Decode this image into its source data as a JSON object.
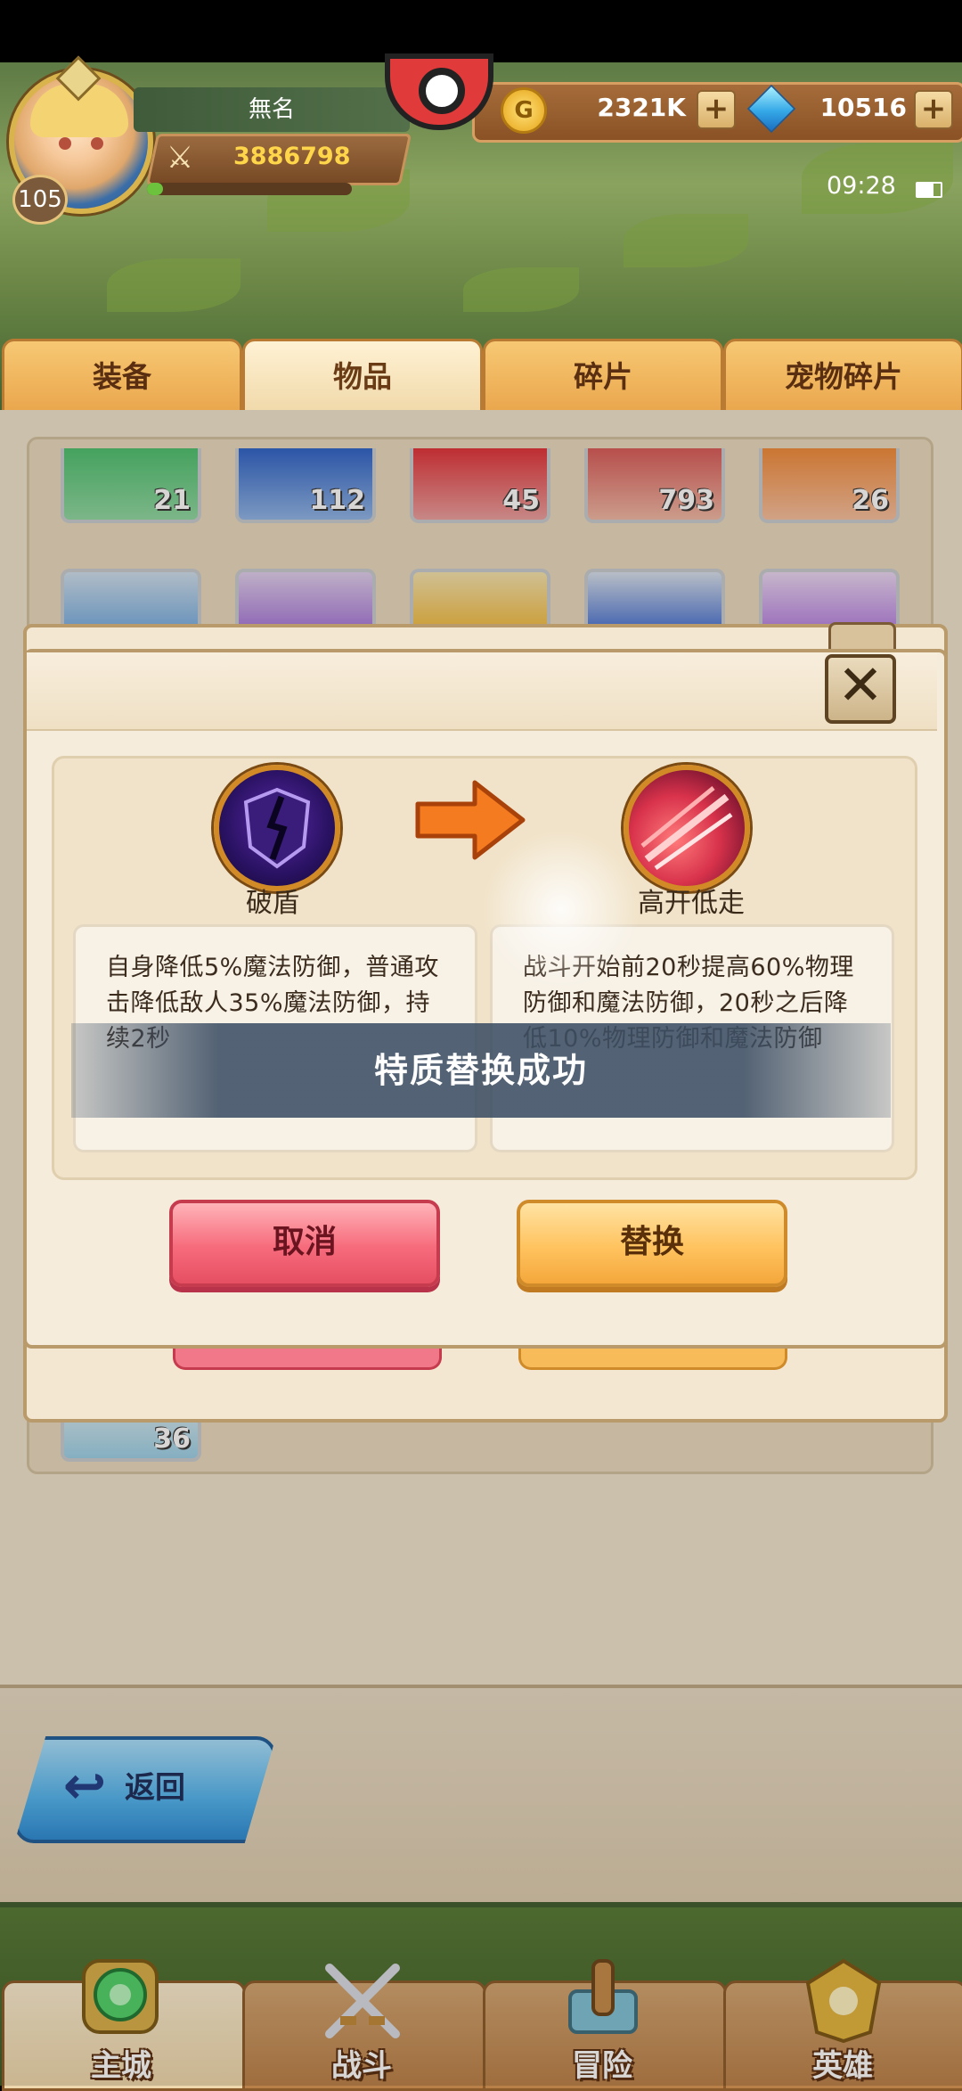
{
  "player": {
    "name": "無名",
    "level": "105",
    "power": "3886798",
    "exp_fraction": 0.08
  },
  "currency": {
    "gold": "2321K",
    "gold_symbol": "G",
    "gems": "10516",
    "plus": "+"
  },
  "status": {
    "time": "09:28"
  },
  "tabs": [
    "装备",
    "物品",
    "碎片",
    "宠物碎片"
  ],
  "active_tab": "物品",
  "inventory": {
    "row1_counts": [
      "21",
      "112",
      "45",
      "793",
      "26"
    ],
    "last_count": "36"
  },
  "dialog": {
    "close_glyph": "✕",
    "old_trait": {
      "name": "破盾",
      "desc": "自身降低5%魔法防御，普通攻击降低敌人35%魔法防御，持续2秒"
    },
    "new_trait": {
      "name": "高开低走",
      "desc": "战斗开始前20秒提高60%物理防御和魔法防御，20秒之后降低10%物理防御和魔法防御"
    },
    "cancel_label": "取消",
    "replace_label": "替换",
    "toast": "特质替换成功"
  },
  "back": {
    "label": "返回",
    "icon": "↩"
  },
  "nav": [
    "主城",
    "战斗",
    "冒险",
    "英雄"
  ],
  "colors": {
    "gold": "#ffd54a",
    "cancel": "#f66b7c",
    "replace": "#ffc35f",
    "back": "#4fb3f0"
  }
}
